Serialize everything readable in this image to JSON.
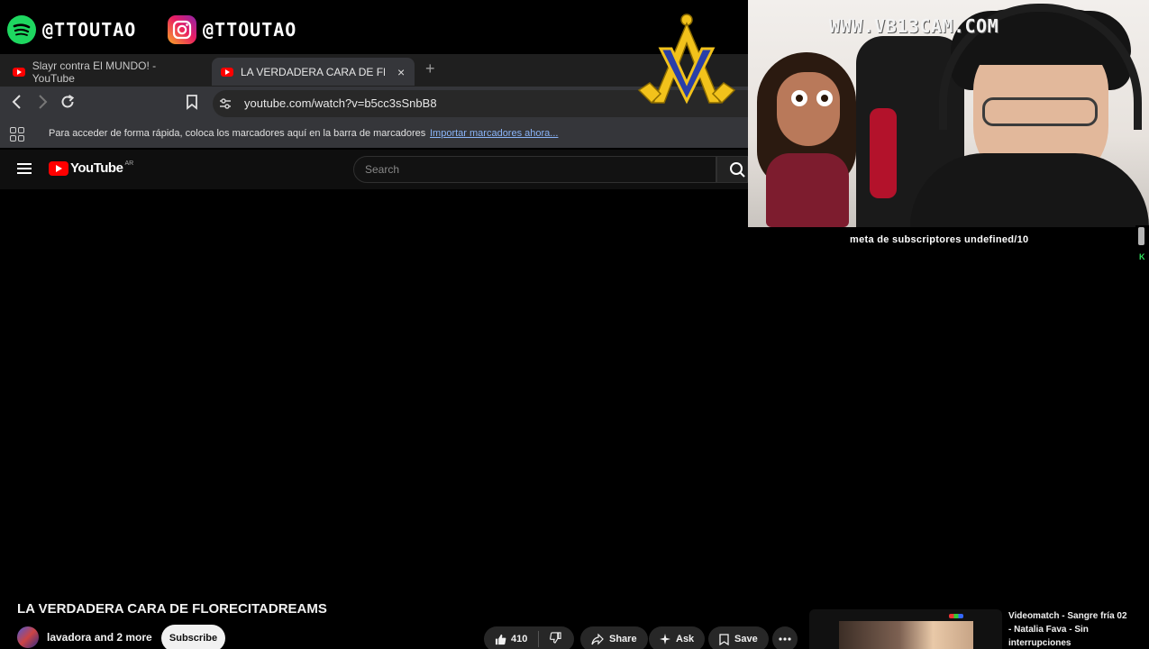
{
  "overlay": {
    "spotify_handle": "@TTOUTAO",
    "instagram_handle": "@TTOUTAO",
    "cam_watermark": "WWW.VB13CAM.COM",
    "subscriber_goal": "meta de subscriptores undefined/10"
  },
  "browser": {
    "tabs": [
      {
        "label": "Slayr contra El MUNDO! - YouTube",
        "active": false
      },
      {
        "label": "LA VERDADERA CARA DE FLORE",
        "active": true
      }
    ],
    "new_tab_symbol": "+",
    "close_symbol": "×",
    "url": "youtube.com/watch?v=b5cc3sSnbB8",
    "bookmarks_message": "Para acceder de forma rápida, coloca los marcadores aquí en la barra de marcadores",
    "bookmarks_link": "Importar marcadores ahora..."
  },
  "youtube": {
    "logo_word": "YouTube",
    "country_code": "AR",
    "search_placeholder": "Search",
    "video_title": "LA VERDADERA CARA DE FLORECITADREAMS",
    "channel": "lavadora and 2 more",
    "subscribe_label": "Subscribe",
    "likes": "410",
    "share_label": "Share",
    "ask_label": "Ask",
    "save_label": "Save",
    "recommended_title": "Videomatch - Sangre fría 02 - Natalia Fava - Sin interrupciones"
  },
  "colors": {
    "youtube_red": "#ff0000",
    "spotify_green": "#1ed760",
    "link_blue": "#8ab4f8",
    "emblem_gold": "#f2c21b",
    "emblem_blue": "#2a3fa8"
  },
  "icons": [
    "spotify-icon",
    "instagram-icon",
    "youtube-tab-icon",
    "back-icon",
    "forward-icon",
    "reload-icon",
    "bookmark-icon",
    "tune-icon",
    "apps-icon",
    "menu-icon",
    "search-icon",
    "like-icon",
    "dislike-icon",
    "share-icon",
    "ask-icon",
    "save-icon",
    "more-icon"
  ]
}
